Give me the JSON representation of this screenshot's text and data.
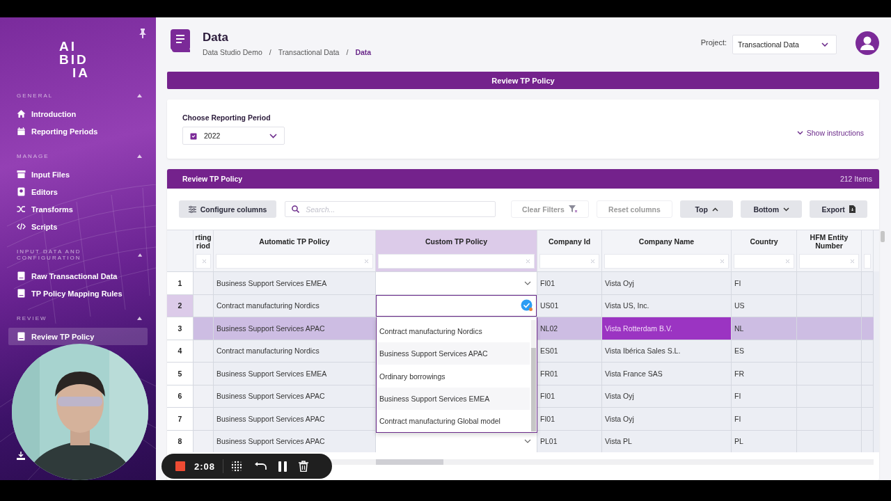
{
  "sidebar": {
    "logo": [
      "AI",
      "BID",
      "IA"
    ],
    "sections": [
      {
        "title": "GENERAL",
        "expanded": true,
        "items": [
          {
            "label": "Introduction",
            "kind": "home",
            "selected": false
          },
          {
            "label": "Reporting Periods",
            "kind": "calendar",
            "selected": false
          }
        ]
      },
      {
        "title": "MANAGE",
        "expanded": true,
        "items": [
          {
            "label": "Input Files",
            "kind": "archive",
            "selected": false
          },
          {
            "label": "Editors",
            "kind": "badge",
            "selected": false
          },
          {
            "label": "Transforms",
            "kind": "shuffle",
            "selected": false
          },
          {
            "label": "Scripts",
            "kind": "code",
            "selected": false
          }
        ]
      },
      {
        "title": "INPUT DATA AND CONFIGURATION",
        "expanded": true,
        "items": [
          {
            "label": "Raw Transactional Data",
            "kind": "book",
            "selected": false
          },
          {
            "label": "TP Policy Mapping Rules",
            "kind": "book",
            "selected": false
          }
        ]
      },
      {
        "title": "REVIEW",
        "expanded": true,
        "items": [
          {
            "label": "Review TP Policy",
            "kind": "book",
            "selected": true
          }
        ]
      }
    ]
  },
  "header": {
    "title": "Data",
    "breadcrumb_separators": [
      "/",
      "/"
    ],
    "breadcrumb": [
      {
        "label": "Data Studio Demo",
        "current": false
      },
      {
        "label": "Transactional Data",
        "current": false
      },
      {
        "label": "Data",
        "current": true
      }
    ],
    "project_label": "Project:",
    "project_value": "Transactional Data"
  },
  "banner": {
    "title": "Review TP Policy"
  },
  "period_card": {
    "label": "Choose Reporting Period",
    "value": "2022",
    "instructions_link": "Show instructions"
  },
  "table_panel": {
    "title": "Review TP Policy",
    "count": "212 Items",
    "configure_button": "Configure columns",
    "search": {
      "placeholder": "Search..."
    },
    "buttons": [
      {
        "label": "Clear Filters",
        "kind": "filter",
        "disabled": true
      },
      {
        "label": "Reset columns",
        "kind": "plain",
        "disabled": true
      },
      {
        "label": "Top",
        "kind": "up",
        "disabled": false
      },
      {
        "label": "Bottom",
        "kind": "down",
        "disabled": false
      },
      {
        "label": "Export",
        "kind": "file",
        "disabled": false
      }
    ]
  },
  "table": {
    "columns": [
      {
        "label": "rting riod",
        "selected": false
      },
      {
        "label": "Automatic TP Policy",
        "selected": false
      },
      {
        "label": "Custom TP Policy",
        "selected": true
      },
      {
        "label": "Company Id",
        "selected": false
      },
      {
        "label": "Company Name",
        "selected": false
      },
      {
        "label": "Country",
        "selected": false
      },
      {
        "label": "HFM Entity Number",
        "selected": false
      }
    ],
    "rows": [
      {
        "number": "1",
        "automatic": "Business Support Services EMEA",
        "custom_cell": {
          "kind": "closed"
        },
        "company_id": "FI01",
        "company_name": "Vista Oyj",
        "country": "FI",
        "selected": false,
        "name_cell_active": false
      },
      {
        "number": "2",
        "automatic": "Contract manufacturing Nordics",
        "custom_cell": {
          "kind": "editing"
        },
        "company_id": "US01",
        "company_name": "Vista US, Inc.",
        "country": "US",
        "selected": false,
        "name_cell_active": false
      },
      {
        "number": "3",
        "automatic": "Business Support Services APAC",
        "custom_cell": {
          "kind": "covered"
        },
        "company_id": "NL02",
        "company_name": "Vista Rotterdam B.V.",
        "country": "NL",
        "selected": true,
        "name_cell_active": true
      },
      {
        "number": "4",
        "automatic": "Contract manufacturing Nordics",
        "custom_cell": {
          "kind": "covered"
        },
        "company_id": "ES01",
        "company_name": "Vista Ibérica Sales S.L.",
        "country": "ES",
        "selected": false,
        "name_cell_active": false
      },
      {
        "number": "5",
        "automatic": "Business Support Services EMEA",
        "custom_cell": {
          "kind": "covered"
        },
        "company_id": "FR01",
        "company_name": "Vista France SAS",
        "country": "FR",
        "selected": false,
        "name_cell_active": false
      },
      {
        "number": "6",
        "automatic": "Business Support Services APAC",
        "custom_cell": {
          "kind": "covered"
        },
        "company_id": "FI01",
        "company_name": "Vista Oyj",
        "country": "FI",
        "selected": false,
        "name_cell_active": false
      },
      {
        "number": "7",
        "automatic": "Business Support Services APAC",
        "custom_cell": {
          "kind": "covered"
        },
        "company_id": "FI01",
        "company_name": "Vista Oyj",
        "country": "FI",
        "selected": false,
        "name_cell_active": false
      },
      {
        "number": "8",
        "automatic": "Business Support Services APAC",
        "custom_cell": {
          "kind": "closed"
        },
        "company_id": "PL01",
        "company_name": "Vista PL",
        "country": "PL",
        "selected": false,
        "name_cell_active": false
      }
    ],
    "dropdown": {
      "options": [
        "Contract manufacturing Nordics",
        "Business Support Services APAC",
        "Ordinary borrowings",
        "Business Support Services EMEA",
        "Contract manufacturing Global model"
      ]
    }
  },
  "recorder": {
    "time": "2:08"
  }
}
